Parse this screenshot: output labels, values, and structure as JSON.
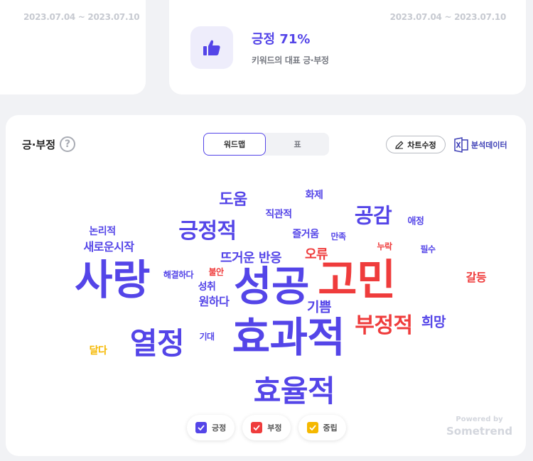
{
  "card_left": {
    "date_range": "2023.07.04 ~ 2023.07.10"
  },
  "card_right": {
    "date_range": "2023.07.04 ~ 2023.07.10",
    "icon": "thumbs-up-icon",
    "title": "긍정 71%",
    "subtitle": "키워드의 대표 긍·부정"
  },
  "main": {
    "title": "긍·부정",
    "help_label": "?",
    "tabs": [
      {
        "label": "워드맵",
        "active": true
      },
      {
        "label": "표",
        "active": false
      }
    ],
    "edit_button": "차트수정",
    "export_button": "분석데이터",
    "legend": [
      {
        "label": "긍정",
        "color": "#5445e8"
      },
      {
        "label": "부정",
        "color": "#ef3c3c"
      },
      {
        "label": "중립",
        "color": "#f5b800"
      }
    ],
    "powered_by": "Powered by",
    "brand": "Sometrend"
  },
  "colors": {
    "positive": "#5445e8",
    "negative": "#ef3c3c",
    "neutral": "#f5b800",
    "accent": "#5445e8"
  },
  "words": [
    {
      "text": "도움",
      "sentiment": "positive"
    },
    {
      "text": "화제",
      "sentiment": "positive"
    },
    {
      "text": "직관적",
      "sentiment": "positive"
    },
    {
      "text": "공감",
      "sentiment": "positive"
    },
    {
      "text": "애정",
      "sentiment": "positive"
    },
    {
      "text": "논리적",
      "sentiment": "positive"
    },
    {
      "text": "긍정적",
      "sentiment": "positive"
    },
    {
      "text": "즐거움",
      "sentiment": "positive"
    },
    {
      "text": "만족",
      "sentiment": "positive"
    },
    {
      "text": "새로운시작",
      "sentiment": "positive"
    },
    {
      "text": "누락",
      "sentiment": "negative"
    },
    {
      "text": "필수",
      "sentiment": "positive"
    },
    {
      "text": "뜨거운 반응",
      "sentiment": "positive"
    },
    {
      "text": "오류",
      "sentiment": "negative"
    },
    {
      "text": "사랑",
      "sentiment": "positive"
    },
    {
      "text": "해결하다",
      "sentiment": "positive"
    },
    {
      "text": "불안",
      "sentiment": "negative"
    },
    {
      "text": "성공",
      "sentiment": "positive"
    },
    {
      "text": "고민",
      "sentiment": "negative"
    },
    {
      "text": "갈등",
      "sentiment": "negative"
    },
    {
      "text": "성취",
      "sentiment": "positive"
    },
    {
      "text": "원하다",
      "sentiment": "positive"
    },
    {
      "text": "기쁨",
      "sentiment": "positive"
    },
    {
      "text": "부정적",
      "sentiment": "negative"
    },
    {
      "text": "희망",
      "sentiment": "positive"
    },
    {
      "text": "열정",
      "sentiment": "positive"
    },
    {
      "text": "기대",
      "sentiment": "positive"
    },
    {
      "text": "효과적",
      "sentiment": "positive"
    },
    {
      "text": "달다",
      "sentiment": "neutral"
    },
    {
      "text": "효율적",
      "sentiment": "positive"
    }
  ]
}
